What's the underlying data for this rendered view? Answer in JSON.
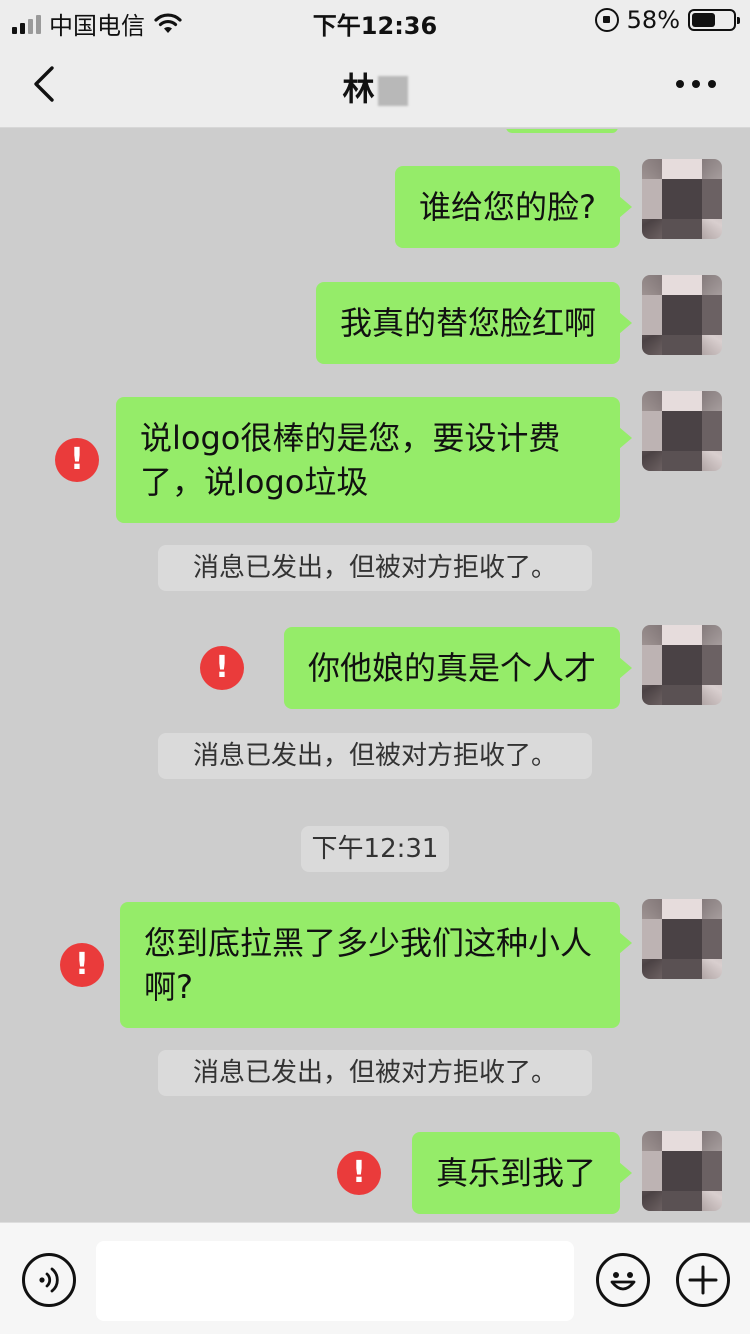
{
  "status_bar": {
    "carrier": "中国电信",
    "time": "下午12:36",
    "battery": "58%",
    "battery_level": 0.58
  },
  "nav": {
    "title": "林",
    "back_icon": "chevron-left-icon",
    "more_icon": "more-icon"
  },
  "messages": [
    {
      "type": "sent",
      "text": "谁给您的脸?",
      "failed": false
    },
    {
      "type": "sent",
      "text": "我真的替您脸红啊",
      "failed": false
    },
    {
      "type": "sent",
      "text": "说logo很棒的是您，要设计费了，说logo垃圾",
      "failed": true
    },
    {
      "type": "system",
      "text": "消息已发出，但被对方拒收了。"
    },
    {
      "type": "sent",
      "text": "你他娘的真是个人才",
      "failed": true
    },
    {
      "type": "system",
      "text": "消息已发出，但被对方拒收了。"
    },
    {
      "type": "time",
      "text": "下午12:31"
    },
    {
      "type": "sent",
      "text": "您到底拉黑了多少我们这种小人啊?",
      "failed": true
    },
    {
      "type": "system",
      "text": "消息已发出，但被对方拒收了。"
    },
    {
      "type": "sent",
      "text": "真乐到我了",
      "failed": true
    }
  ],
  "error_mark": "!",
  "input": {
    "value": "",
    "voice_icon": "voice-icon",
    "emoji_icon": "emoji-icon",
    "plus_icon": "plus-icon"
  },
  "colors": {
    "bubble_sent": "#95ec69",
    "error": "#ea3b3b",
    "chat_bg": "#cdcdcd"
  }
}
